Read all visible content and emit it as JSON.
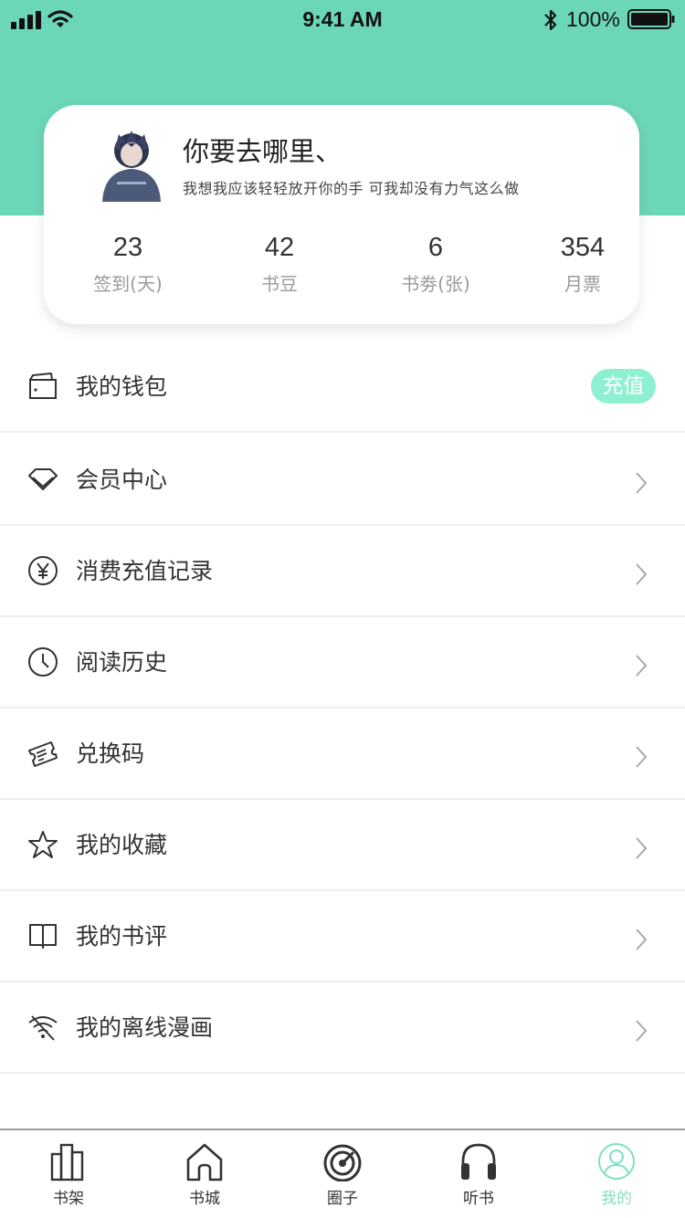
{
  "status_bar": {
    "time": "9:41 AM",
    "battery": "100%"
  },
  "profile": {
    "name": "你要去哪里、",
    "bio": "我想我应该轻轻放开你的手 可我却没有力气这么做",
    "stats": [
      {
        "value": "23",
        "label": "签到(天)"
      },
      {
        "value": "42",
        "label": "书豆"
      },
      {
        "value": "6",
        "label": "书劵(张)"
      },
      {
        "value": "354",
        "label": "月票"
      }
    ]
  },
  "menu": {
    "wallet": {
      "label": "我的钱包",
      "icon": "wallet-icon",
      "badge": "充值"
    },
    "items": [
      {
        "label": "会员中心",
        "icon": "diamond-icon"
      },
      {
        "label": "消费充值记录",
        "icon": "yen-coin-icon"
      },
      {
        "label": "阅读历史",
        "icon": "clock-icon"
      },
      {
        "label": "兑换码",
        "icon": "ticket-icon"
      },
      {
        "label": "我的收藏",
        "icon": "star-icon"
      },
      {
        "label": "我的书评",
        "icon": "open-book-icon"
      },
      {
        "label": "我的离线漫画",
        "icon": "offline-wifi-icon"
      }
    ]
  },
  "tabbar": {
    "tabs": [
      {
        "label": "书架",
        "icon": "bookshelf-icon"
      },
      {
        "label": "书城",
        "icon": "home-icon"
      },
      {
        "label": "圈子",
        "icon": "target-icon"
      },
      {
        "label": "听书",
        "icon": "headphones-icon"
      },
      {
        "label": "我的",
        "icon": "user-icon"
      }
    ],
    "active_index": 4
  },
  "colors": {
    "accent": "#6cd6b8",
    "badge": "#8ef0d0",
    "active_tab": "#7fe0c2"
  }
}
